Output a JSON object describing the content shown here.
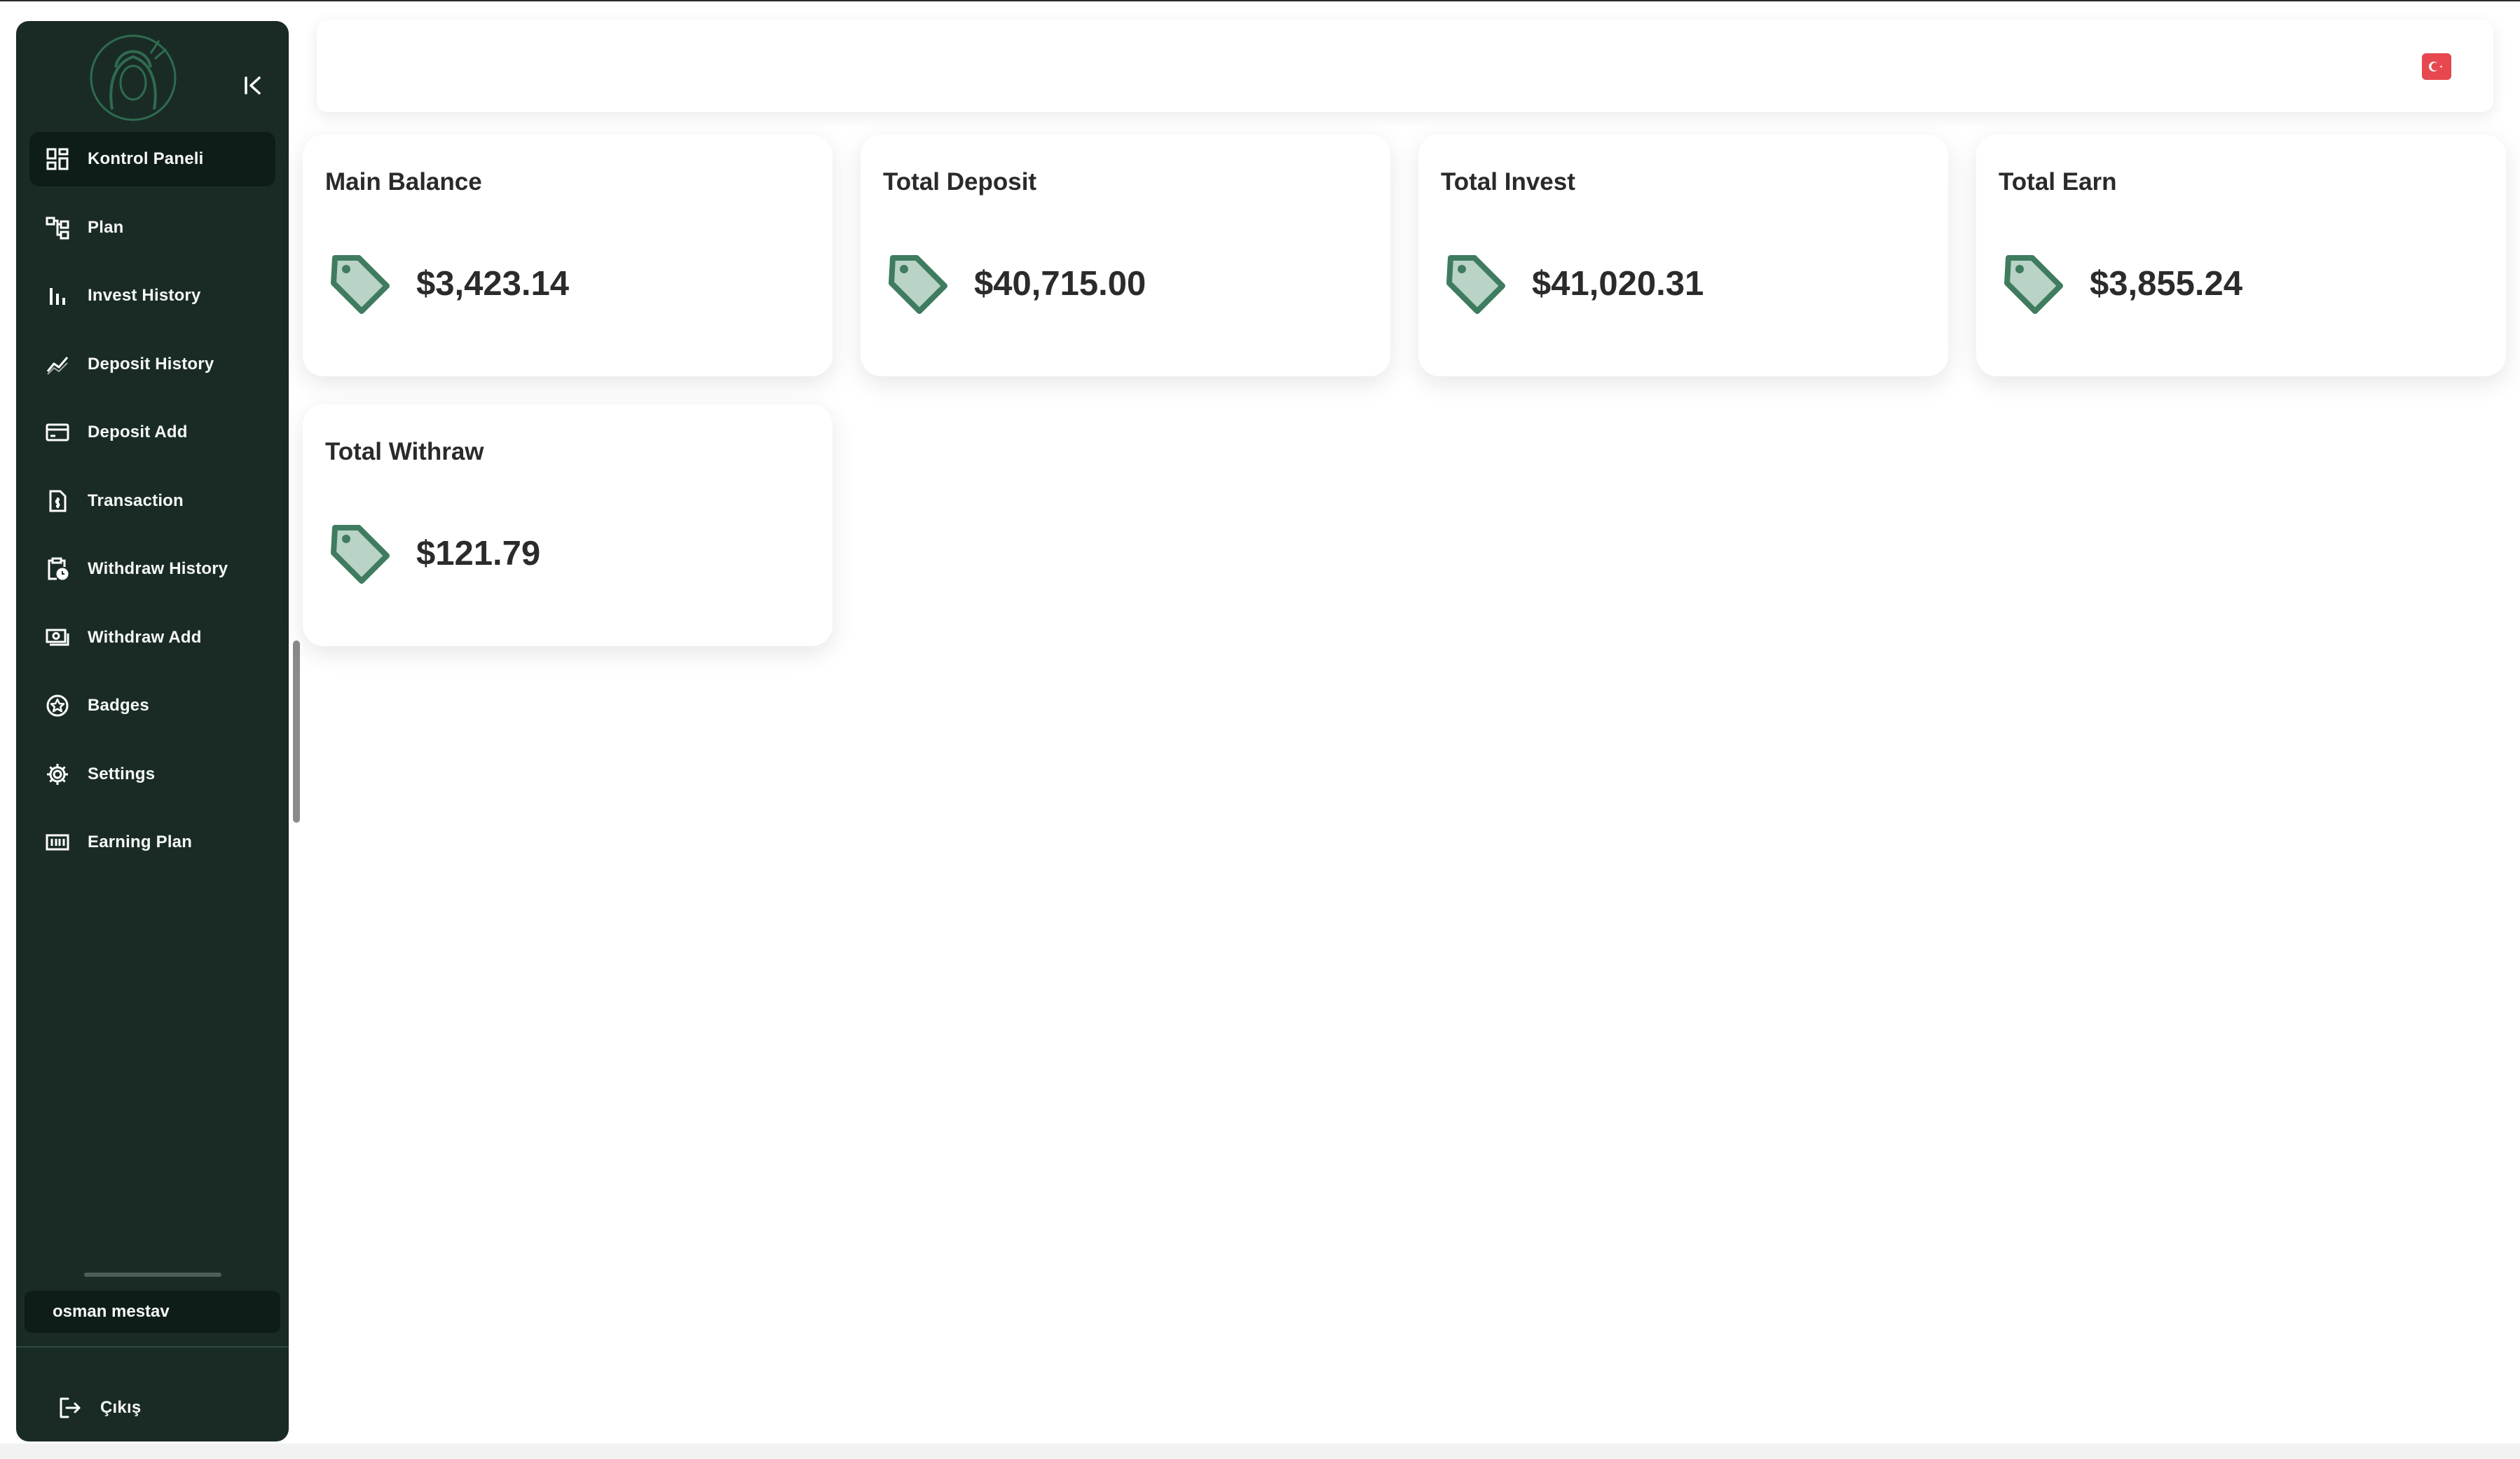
{
  "sidebar": {
    "logo_icon": "woman-portrait-logo",
    "collapse_icon": "collapse-left-icon",
    "items": [
      {
        "label": "Kontrol Paneli",
        "icon": "dashboard-icon",
        "active": true
      },
      {
        "label": "Plan",
        "icon": "hierarchy-icon",
        "active": false
      },
      {
        "label": "Invest History",
        "icon": "bar-chart-icon",
        "active": false
      },
      {
        "label": "Deposit History",
        "icon": "trend-line-icon",
        "active": false
      },
      {
        "label": "Deposit Add",
        "icon": "credit-card-icon",
        "active": false
      },
      {
        "label": "Transaction",
        "icon": "invoice-icon",
        "active": false
      },
      {
        "label": "Withdraw History",
        "icon": "clipboard-clock-icon",
        "active": false
      },
      {
        "label": "Withdraw Add",
        "icon": "banknote-icon",
        "active": false
      },
      {
        "label": "Badges",
        "icon": "star-badge-icon",
        "active": false
      },
      {
        "label": "Settings",
        "icon": "gear-icon",
        "active": false
      },
      {
        "label": "Earning Plan",
        "icon": "price-list-icon",
        "active": false
      }
    ],
    "user_name": "osman mestav",
    "logout_label": "Çıkış",
    "logout_icon": "logout-icon"
  },
  "header": {
    "language_flag": "turkey-flag-icon"
  },
  "cards": [
    {
      "title": "Main Balance",
      "value": "$3,423.14",
      "icon": "price-tag-icon"
    },
    {
      "title": "Total Deposit",
      "value": "$40,715.00",
      "icon": "price-tag-icon"
    },
    {
      "title": "Total Invest",
      "value": "$41,020.31",
      "icon": "price-tag-icon"
    },
    {
      "title": "Total Earn",
      "value": "$3,855.24",
      "icon": "price-tag-icon"
    },
    {
      "title": "Total Withraw",
      "value": "$121.79",
      "icon": "price-tag-icon"
    }
  ],
  "colors": {
    "sidebar_bg": "#1a2b25",
    "sidebar_active_bg": "#0f1d19",
    "accent_green": "#3f7c5f",
    "tag_fill": "#b9d3c6",
    "flag_red": "#e7484f"
  }
}
